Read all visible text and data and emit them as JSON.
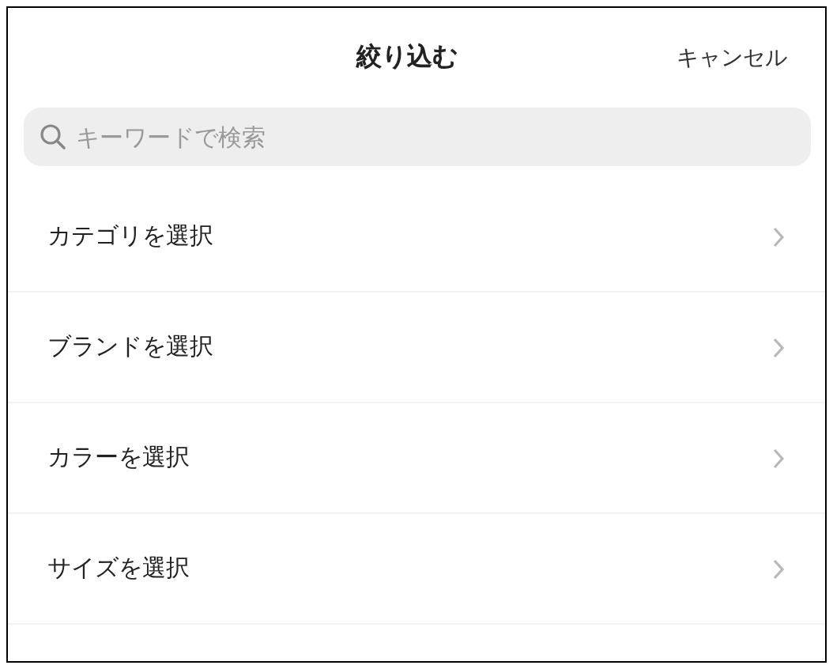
{
  "header": {
    "title": "絞り込む",
    "cancel": "キャンセル"
  },
  "search": {
    "placeholder": "キーワードで検索"
  },
  "options": [
    {
      "label": "カテゴリを選択"
    },
    {
      "label": "ブランドを選択"
    },
    {
      "label": "カラーを選択"
    },
    {
      "label": "サイズを選択"
    }
  ]
}
